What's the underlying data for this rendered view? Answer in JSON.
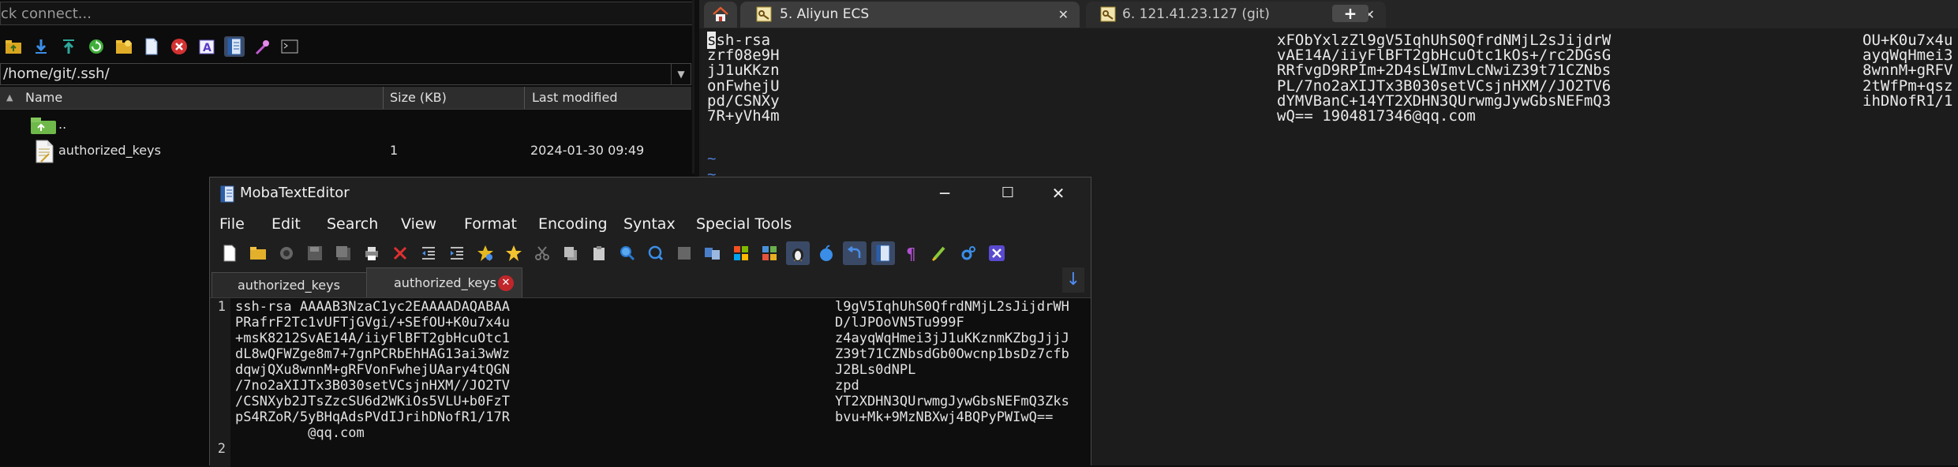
{
  "sftp": {
    "quick_connect": "ck connect...",
    "path": "/home/git/.ssh/",
    "columns": {
      "name": "Name",
      "size": "Size (KB)",
      "modified": "Last modified"
    },
    "rows": [
      {
        "name": "..",
        "size": "",
        "modified": ""
      },
      {
        "name": "authorized_keys",
        "size": "1",
        "modified": "2024-01-30 09:49"
      }
    ],
    "toolbar_icons": [
      "folder-up-icon",
      "download-icon",
      "upload-icon",
      "refresh-icon",
      "new-folder-icon",
      "new-file-icon",
      "delete-icon",
      "rename-icon",
      "open-text-editor-icon",
      "properties-icon",
      "terminal-icon"
    ]
  },
  "terminal": {
    "tabs": [
      {
        "label": "5. Aliyun ECS"
      },
      {
        "label": "6. 121.41.23.127 (git)"
      }
    ],
    "lines_col1": [
      "ssh-rsa",
      "zrf08e9H",
      "jJ1uKKzn",
      "onFwhejU",
      "pd/CSNXy",
      "7R+yVh4m"
    ],
    "lines_col2": [
      "xFObYxlzZl9gV5IqhUhS0QfrdNMjL2sJijdrW",
      "vAE14A/iiyFlBFT2gbHcuOtc1kOs+/rc2DGsG",
      "RRfvgD9RPIm+2D4sLWImvLcNwiZ39t71CZNbs",
      "PL/7no2aXIJTx3B030setVCsjnHXM//JO2TV6",
      "dYMVBanC+14YT2XDHN3QUrwmgJywGbsNEFmQ3",
      "wQ== 1904817346@qq.com"
    ],
    "lines_col3": [
      "OU+K0u7x4u",
      "ayqWqHmei3",
      "8wnnM+gRFV",
      "2tWfPm+qsz",
      "ihDNofR1/1",
      ""
    ],
    "tilde": "~"
  },
  "editor": {
    "title": "MobaTextEditor",
    "menu": [
      "File",
      "Edit",
      "Search",
      "View",
      "Format",
      "Encoding",
      "Syntax",
      "Special Tools"
    ],
    "tabs": [
      {
        "label": "authorized_keys"
      },
      {
        "label": "authorized_keys"
      }
    ],
    "line_numbers": [
      "1",
      "2"
    ],
    "left_text": [
      "ssh-rsa AAAAB3NzaC1yc2EAAAADAQABAA",
      "PRafrF2Tc1vUFTjGVgi/+SEfOU+K0u7x4u",
      "+msK8212SvAE14A/iiyFlBFT2gbHcuOtc1",
      "dL8wQFWZge8m7+7gnPCRbEhHAG13ai3wWz",
      "dqwjQXu8wnnM+gRFVonFwhejUAary4tQGN",
      "/7no2aXIJTx3B030setVCsjnHXM//JO2TV",
      "/CSNXyb2JTsZzcSU6d2WKiOs5VLU+b0FzT",
      "pS4RZoR/5yBHqAdsPVdIJrihDNofR1/17R",
      "         @qq.com"
    ],
    "right_text": [
      "l9gV5IqhUhS0QfrdNMjL2sJijdrWH",
      "D/lJPOoVN5Tu999F",
      "z4ayqWqHmei3jJ1uKKznmKZbgJjjJ",
      "Z39t71CZNbsdGb0Owcnp1bsDz7cfb",
      "J2BLs0dNPL",
      "zpd",
      "YT2XDHN3QUrwmgJywGbsNEFmQ3Zks",
      "bvu+Mk+9MzNBXwj4BQPyPWIwQ=="
    ]
  }
}
